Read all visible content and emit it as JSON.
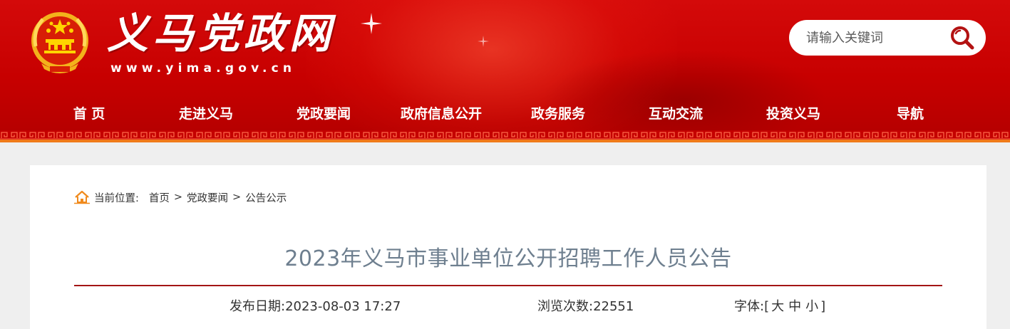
{
  "header": {
    "site_title": "义马党政网",
    "site_url": "www.yima.gov.cn",
    "search_placeholder": "请输入关键词"
  },
  "nav": {
    "items": [
      "首 页",
      "走进义马",
      "党政要闻",
      "政府信息公开",
      "政务服务",
      "互动交流",
      "投资义马",
      "导航"
    ]
  },
  "breadcrumb": {
    "label": "当前位置:",
    "items": [
      "首页",
      "党政要闻",
      "公告公示"
    ],
    "separator": ">"
  },
  "article": {
    "title": "2023年义马市事业单位公开招聘工作人员公告",
    "publish_date": "发布日期:2023-08-03 17:27",
    "views": "浏览次数:22551",
    "font_label": "字体:[",
    "font_large": "大",
    "font_medium": "中",
    "font_small": "小",
    "font_close": "]"
  },
  "colors": {
    "header_red": "#c70000",
    "accent_orange": "#f07a1a",
    "title_rule": "#a31515",
    "title_text": "#6e7f8f"
  }
}
